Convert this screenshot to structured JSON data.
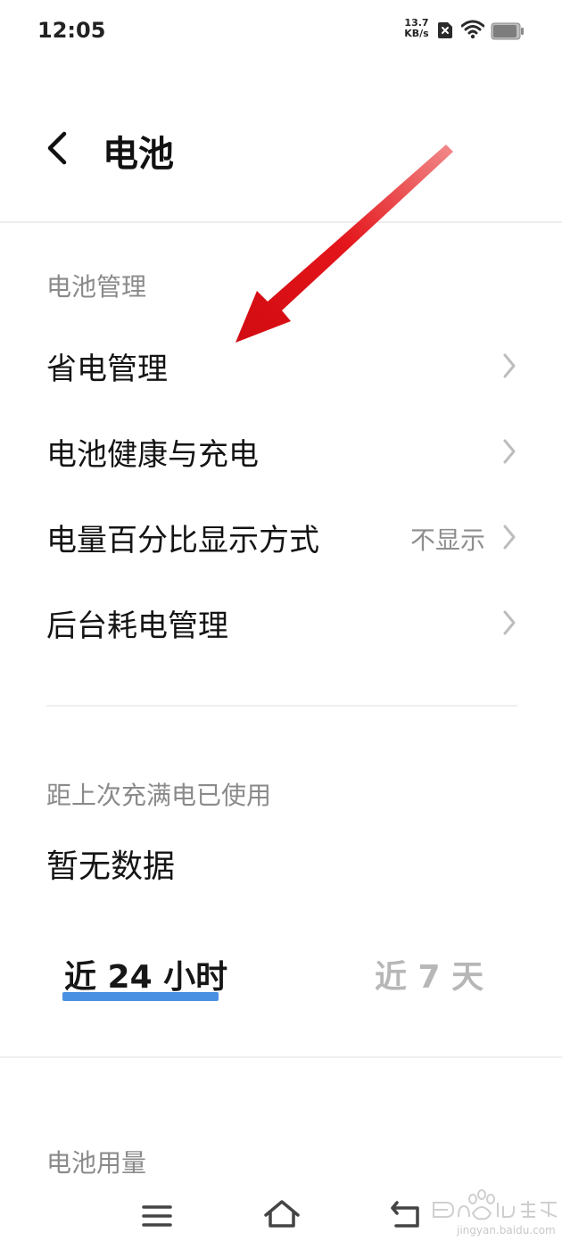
{
  "status_bar": {
    "time": "12:05",
    "net_speed_value": "13.7",
    "net_speed_unit": "KB/s",
    "icons": [
      "sim-error-icon",
      "wifi-icon",
      "battery-icon"
    ]
  },
  "header": {
    "title": "电池",
    "back_icon": "back-arrow-icon"
  },
  "battery_management": {
    "section_label": "电池管理",
    "items": [
      {
        "label": "省电管理",
        "value": ""
      },
      {
        "label": "电池健康与充电",
        "value": ""
      },
      {
        "label": "电量百分比显示方式",
        "value": "不显示"
      },
      {
        "label": "后台耗电管理",
        "value": ""
      }
    ]
  },
  "usage_since_charge": {
    "section_label": "距上次充满电已使用",
    "value": "暂无数据"
  },
  "tabs": [
    {
      "label": "近 24 小时",
      "selected": true
    },
    {
      "label": "近 7 天",
      "selected": false
    }
  ],
  "battery_usage": {
    "section_label": "电池用量"
  },
  "nav_bar": {
    "icons": [
      "menu-icon",
      "home-icon",
      "back-icon"
    ]
  },
  "watermark": {
    "subtext": "jingyan.baidu.com"
  },
  "colors": {
    "accent": "#4a90e2",
    "annotation_arrow": "#e3151a",
    "secondary_text": "#8a8a8a"
  }
}
